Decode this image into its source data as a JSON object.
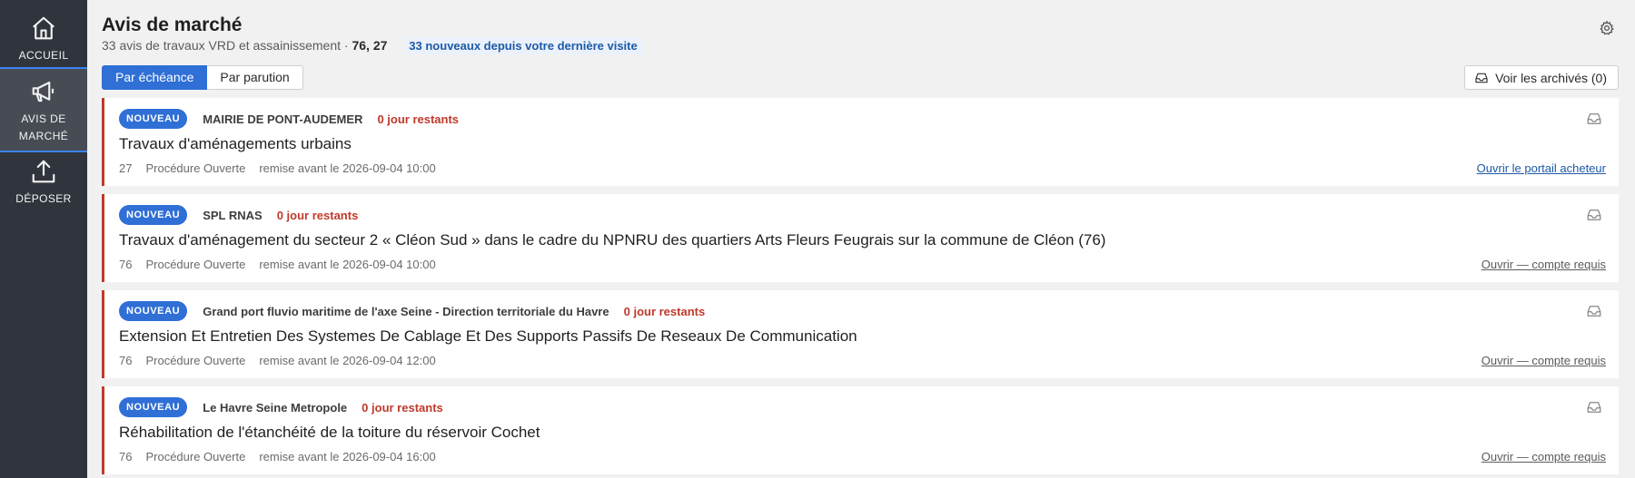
{
  "sidebar": {
    "items": [
      {
        "label": "ACCUEIL",
        "icon": "home-icon"
      },
      {
        "label": "AVIS DE MARCHÉ",
        "icon": "megaphone-icon",
        "active": true
      },
      {
        "label": "DÉPOSER",
        "icon": "upload-icon"
      }
    ]
  },
  "header": {
    "title": "Avis de marché",
    "subtitle_count": "33 avis de travaux VRD et assainissement · ",
    "subtitle_codes": "76, 27",
    "new_since": "33 nouveaux depuis votre dernière visite"
  },
  "tabs": [
    {
      "label": "Par échéance",
      "active": true
    },
    {
      "label": "Par parution",
      "active": false
    }
  ],
  "archives_button": "Voir les archivés (0)",
  "notices": [
    {
      "badge": "NOUVEAU",
      "buyer": "MAIRIE DE PONT-AUDEMER",
      "days_left": "0 jour restants",
      "title": "Travaux d'aménagements urbains",
      "department": "27",
      "procedure": "Procédure Ouverte",
      "deadline": "remise avant le 2026-09-04 10:00",
      "link": "Ouvrir le portail acheteur",
      "link_type": "open"
    },
    {
      "badge": "NOUVEAU",
      "buyer": "SPL RNAS",
      "days_left": "0 jour restants",
      "title": "Travaux d'aménagement du secteur 2 « Cléon Sud » dans le cadre du NPNRU des quartiers Arts Fleurs Feugrais sur la commune de Cléon (76)",
      "department": "76",
      "procedure": "Procédure Ouverte",
      "deadline": "remise avant le 2026-09-04 10:00",
      "link": "Ouvrir — compte requis",
      "link_type": "account"
    },
    {
      "badge": "NOUVEAU",
      "buyer": "Grand port fluvio maritime de l'axe Seine - Direction territoriale du Havre",
      "days_left": "0 jour restants",
      "title": "Extension Et Entretien Des Systemes De Cablage Et Des Supports Passifs De Reseaux De Communication",
      "department": "76",
      "procedure": "Procédure Ouverte",
      "deadline": "remise avant le 2026-09-04 12:00",
      "link": "Ouvrir — compte requis",
      "link_type": "account"
    },
    {
      "badge": "NOUVEAU",
      "buyer": "Le Havre Seine Metropole",
      "days_left": "0 jour restants",
      "title": "Réhabilitation de l'étanchéité de la toiture du réservoir Cochet",
      "department": "76",
      "procedure": "Procédure Ouverte",
      "deadline": "remise avant le 2026-09-04 16:00",
      "link": "Ouvrir — compte requis",
      "link_type": "account"
    }
  ],
  "colors": {
    "sidebar_bg": "#30343c",
    "accent": "#2f6fd6",
    "urgent": "#c0392b",
    "link": "#1e5aa6"
  }
}
